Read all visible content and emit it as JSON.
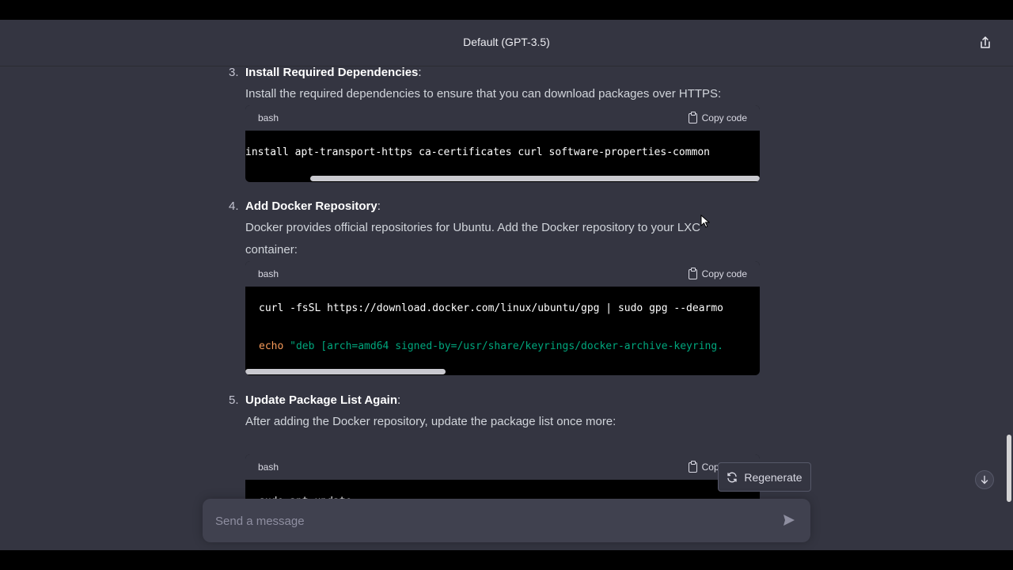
{
  "header": {
    "title": "Default (GPT-3.5)",
    "share_icon": "share-icon"
  },
  "steps": [
    {
      "number": "3.",
      "title": "Install Required Dependencies",
      "suffix": ":",
      "text": "Install the required dependencies to ensure that you can download packages over HTTPS:",
      "code": {
        "language": "bash",
        "copy_label": "Copy code",
        "lines": [
          "install apt-transport-https ca-certificates curl software-properties-common"
        ]
      }
    },
    {
      "number": "4.",
      "title": "Add Docker Repository",
      "suffix": ":",
      "text": "Docker provides official repositories for Ubuntu. Add the Docker repository to your LXC container:",
      "code": {
        "language": "bash",
        "copy_label": "Copy code",
        "line1": "curl -fsSL https://download.docker.com/linux/ubuntu/gpg | sudo gpg --dearmo",
        "line2_keyword": "echo",
        "line2_string": " \"deb [arch=amd64 signed-by=/usr/share/keyrings/docker-archive-keyring."
      }
    },
    {
      "number": "5.",
      "title": "Update Package List Again",
      "suffix": ":",
      "text": "After adding the Docker repository, update the package list once more:",
      "code": {
        "language": "bash",
        "copy_label": "Copy code",
        "lines": [
          "sudo apt update"
        ]
      }
    }
  ],
  "regenerate_label": "Regenerate",
  "composer": {
    "placeholder": "Send a message"
  },
  "colors": {
    "background": "#343541",
    "code_bg": "#000000",
    "keyword": "#f89b5a",
    "string": "#00a67d"
  }
}
